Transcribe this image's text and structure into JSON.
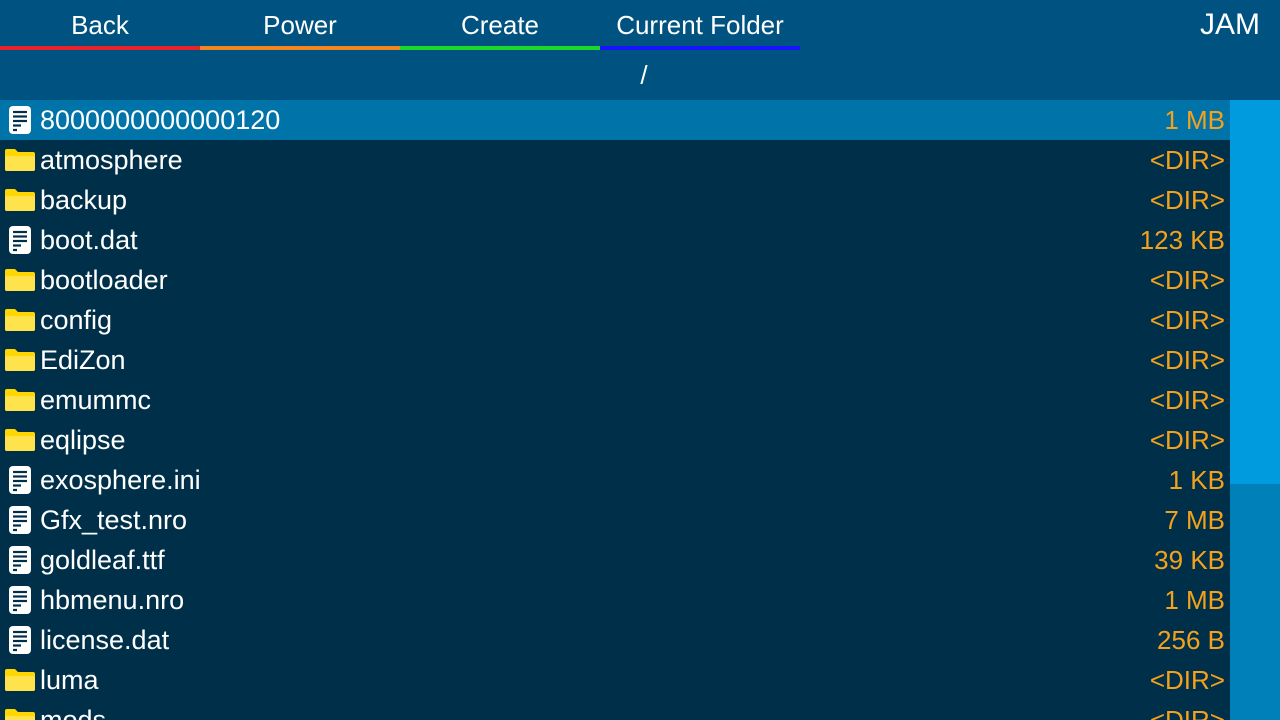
{
  "tabs": [
    {
      "label": "Back",
      "color": "#e8232a"
    },
    {
      "label": "Power",
      "color": "#f28522"
    },
    {
      "label": "Create",
      "color": "#19d92c"
    },
    {
      "label": "Current Folder",
      "color": "#1414ff"
    }
  ],
  "app_title": "JAM",
  "current_path": "/",
  "colors": {
    "background": "#003049",
    "topbar": "#005380",
    "selected_row": "#0074a8",
    "size_text": "#f5a11c",
    "folder": "#ffd700"
  },
  "files": [
    {
      "name": "8000000000000120",
      "size": "1 MB",
      "icon": "file-icon",
      "selected": true
    },
    {
      "name": "atmosphere",
      "size": "<DIR>",
      "icon": "folder-icon"
    },
    {
      "name": "backup",
      "size": "<DIR>",
      "icon": "folder-icon"
    },
    {
      "name": "boot.dat",
      "size": "123 KB",
      "icon": "file-icon"
    },
    {
      "name": "bootloader",
      "size": "<DIR>",
      "icon": "folder-icon"
    },
    {
      "name": "config",
      "size": "<DIR>",
      "icon": "folder-icon"
    },
    {
      "name": "EdiZon",
      "size": "<DIR>",
      "icon": "folder-icon"
    },
    {
      "name": "emummc",
      "size": "<DIR>",
      "icon": "folder-icon"
    },
    {
      "name": "eqlipse",
      "size": "<DIR>",
      "icon": "folder-icon"
    },
    {
      "name": "exosphere.ini",
      "size": "1 KB",
      "icon": "file-icon"
    },
    {
      "name": "Gfx_test.nro",
      "size": "7 MB",
      "icon": "file-icon"
    },
    {
      "name": "goldleaf.ttf",
      "size": "39 KB",
      "icon": "file-icon"
    },
    {
      "name": "hbmenu.nro",
      "size": "1 MB",
      "icon": "file-icon"
    },
    {
      "name": "license.dat",
      "size": "256 B",
      "icon": "file-icon"
    },
    {
      "name": "luma",
      "size": "<DIR>",
      "icon": "folder-icon"
    },
    {
      "name": "mods",
      "size": "<DIR>",
      "icon": "folder-icon"
    }
  ]
}
